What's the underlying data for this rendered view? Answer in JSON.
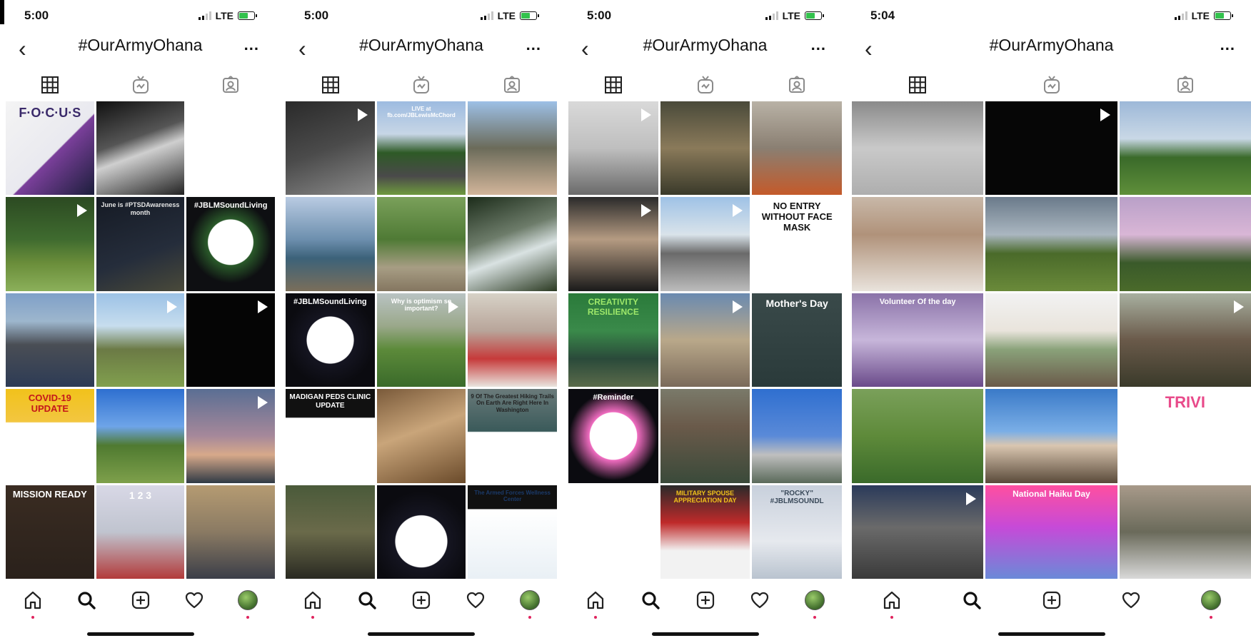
{
  "screens": [
    {
      "time": "5:00",
      "network": "LTE",
      "hashtag": "#OurArmyOhana",
      "more": "...",
      "tiles": [
        {
          "bg": "linear-gradient(135deg,#f4f4f4 0%,#e9e9ef 55%,#7a3f9a 56%,#1b1e3b 100%)",
          "text": "F·O·C·U·S",
          "fg": "#3a2a6a",
          "size": 18,
          "play": false
        },
        {
          "bg": "linear-gradient(160deg,#111 0%,#555 40%,#cfcfcf 55%,#222 100%)",
          "text": "",
          "play": false
        },
        {
          "bg": "#ffffff",
          "text": "",
          "play": false
        },
        {
          "bg": "linear-gradient(180deg,#2c4a22 0%,#3f6b2f 45%,#6a8d3a 70%,#8bb05a 100%)",
          "text": "",
          "play": true
        },
        {
          "bg": "linear-gradient(160deg,#151a24 0%,#252d3b 60%,#4a4a3a 100%)",
          "text": "June is #PTSDAwareness month",
          "fg": "#e6e6e6",
          "size": 9,
          "play": false
        },
        {
          "bg": "radial-gradient(circle at 50% 48%,#ffffff 0%,#ffffff 34%,#2a5a2a 35%,#0e0f12 62%)",
          "text": "#JBLMSoundLiving",
          "fg": "#ffffff",
          "size": 11,
          "play": false
        },
        {
          "bg": "linear-gradient(180deg,#7fa0c8 0%,#9db6cd 30%,#4a4e55 55%,#2d3b55 100%)",
          "text": "",
          "play": false
        },
        {
          "bg": "linear-gradient(180deg,#9cc2e6 0%,#c7ddee 35%,#6b7a45 60%,#81a04e 100%)",
          "text": "",
          "play": true
        },
        {
          "bg": "#050505",
          "text": "",
          "play": true
        },
        {
          "bg": "linear-gradient(180deg,#f1c21b 0%,#f3c640 35%,#ffffff 36%,#ffffff 100%)",
          "text": "COVID-19 UPDATE",
          "fg": "#c4171a",
          "size": 13,
          "play": false
        },
        {
          "bg": "linear-gradient(180deg,#2e6fd0 0%,#6ea4e8 40%,#4f7a30 60%,#7ea04b 100%)",
          "text": "",
          "play": false
        },
        {
          "bg": "linear-gradient(180deg,#5a6e93 0%,#a6889a 50%,#d7a98a 70%,#303a45 100%)",
          "text": "",
          "play": true
        },
        {
          "bg": "linear-gradient(180deg,#3a2c22 0%,#2a211b 100%)",
          "text": "MISSION READY",
          "fg": "#ffffff",
          "size": 13,
          "play": false
        },
        {
          "bg": "linear-gradient(180deg,#d8d8e6 0%,#c0c4cf 50%,#b23a3a 100%)",
          "text": "1  2  3",
          "fg": "#ffffff",
          "size": 14,
          "play": false
        },
        {
          "bg": "linear-gradient(180deg,#b59b72 0%,#8a7a63 50%,#3b3e48 100%)",
          "text": "",
          "play": false
        }
      ]
    },
    {
      "time": "5:00",
      "network": "LTE",
      "hashtag": "#OurArmyOhana",
      "more": "...",
      "tiles": [
        {
          "bg": "linear-gradient(160deg,#2a2a2a 0%,#4b4b4b 50%,#8a8a8a 100%)",
          "text": "",
          "play": true
        },
        {
          "bg": "linear-gradient(180deg,#9dbbe0 0%,#c7d6e6 35%,#2e5a26 55%,#4a4a4a 80%,#6e9a3e 100%)",
          "text": "LIVE at fb.com/JBLewisMcChord",
          "fg": "#ffffff",
          "size": 8,
          "play": false
        },
        {
          "bg": "linear-gradient(180deg,#9dc0e6 0%,#6b6b5a 50%,#d2b59a 100%)",
          "text": "",
          "play": false
        },
        {
          "bg": "linear-gradient(180deg,#b9cbe2 0%,#6d8fae 45%,#3c6279 65%,#7a6e5a 100%)",
          "text": "",
          "play": false
        },
        {
          "bg": "linear-gradient(180deg,#7aa05a 0%,#4f7a35 45%,#a79d84 75%,#847660 100%)",
          "text": "",
          "play": false
        },
        {
          "bg": "linear-gradient(160deg,#1c2c1a 0%,#6d7c6a 40%,#d9e2e2 60%,#2b3a22 100%)",
          "text": "",
          "play": false
        },
        {
          "bg": "radial-gradient(circle at 50% 50%,#ffffff 0%,#ffffff 36%,#151521 37%,#0b0b10 70%)",
          "text": "#JBLMSoundLiving",
          "fg": "#ffffff",
          "size": 11,
          "play": false
        },
        {
          "bg": "linear-gradient(180deg,#b9c3c3 0%,#9aa88a 35%,#5c8a3a 60%,#3a6a2a 100%)",
          "text": "Why is optimism so important?",
          "fg": "#ffffff",
          "size": 9,
          "play": true
        },
        {
          "bg": "linear-gradient(180deg,#d7d2c7 0%,#b8a59a 40%,#c63a3a 70%,#e9e4de 100%)",
          "text": "",
          "play": false
        },
        {
          "bg": "linear-gradient(180deg,#111 0%,#111 30%,#ffffff 31%,#ffffff 100%)",
          "text": "MADIGAN PEDS CLINIC UPDATE",
          "fg": "#ffffff",
          "size": 10,
          "play": false
        },
        {
          "bg": "linear-gradient(160deg,#7a5a3a 0%,#c9a57a 45%,#6a4a2a 100%)",
          "text": "",
          "play": false
        },
        {
          "bg": "linear-gradient(180deg,#6a7a7a 0%,#3a5a5a 45%,#ffffff 46%,#ffffff 100%)",
          "text": "9 Of The Greatest Hiking Trails On Earth Are Right Here In Washington",
          "fg": "#222222",
          "size": 8,
          "play": false
        },
        {
          "bg": "linear-gradient(180deg,#4a5a3a 0%,#6a6a4a 50%,#2a2a22 100%)",
          "text": "",
          "play": false
        },
        {
          "bg": "radial-gradient(circle at 50% 60%,#ffffff 0%,#ffffff 36%,#151521 37%,#0b0b10 70%)",
          "text": "",
          "play": false
        },
        {
          "bg": "linear-gradient(180deg,#111 0%,#111 25%,#ffffff 26%,#e9f0f5 100%)",
          "text": "The Armed Forces Wellness Center",
          "fg": "#1b3a6a",
          "size": 8,
          "play": false
        }
      ]
    },
    {
      "time": "5:00",
      "network": "LTE",
      "hashtag": "#OurArmyOhana",
      "more": "...",
      "tiles": [
        {
          "bg": "linear-gradient(180deg,#d9d9d9 0%,#bfbfbf 50%,#6a6a6a 100%)",
          "text": "",
          "play": true
        },
        {
          "bg": "linear-gradient(180deg,#4a4a3a 0%,#8a7a5a 50%,#3a3a2a 100%)",
          "text": "",
          "play": false
        },
        {
          "bg": "linear-gradient(180deg,#b9b2a6 0%,#8a7f72 50%,#c45a2a 100%)",
          "text": "",
          "play": false
        },
        {
          "bg": "linear-gradient(180deg,#2a2a2a 0%,#b59b82 45%,#1a1a1a 100%)",
          "text": "",
          "play": true
        },
        {
          "bg": "linear-gradient(180deg,#9fc2e6 0%,#d9e3ea 40%,#6a6a6a 60%,#bcbcbc 100%)",
          "text": "",
          "play": true
        },
        {
          "bg": "#ffffff",
          "text": "NO ENTRY WITHOUT FACE MASK",
          "fg": "#111111",
          "size": 13,
          "play": false
        },
        {
          "bg": "linear-gradient(180deg,#2a7a3a 0%,#3a8a4a 40%,#2a4a3a 70%,#5a6a4a 100%)",
          "text": "CREATIVITY RESILIENCE",
          "fg": "#9ee86a",
          "size": 12,
          "play": false
        },
        {
          "bg": "linear-gradient(180deg,#6a8ab0 0%,#b9a88a 50%,#7a6a5a 100%)",
          "text": "",
          "play": true
        },
        {
          "bg": "linear-gradient(180deg,#3a4a4a 0%,#2a3a3a 100%)",
          "text": "Mother's Day",
          "fg": "#ffffff",
          "size": 14,
          "play": false
        },
        {
          "bg": "radial-gradient(circle at 50% 50%,#ffffff 0%,#ffffff 36%,#f06cc0 37%,#0b0b10 68%)",
          "text": "#Reminder",
          "fg": "#ffffff",
          "size": 11,
          "play": false
        },
        {
          "bg": "linear-gradient(180deg,#7a7a6a 0%,#6a5a4a 40%,#3a4a3a 100%)",
          "text": "",
          "play": false
        },
        {
          "bg": "linear-gradient(180deg,#2f6fd0 0%,#5a8ad8 50%,#bfbfbf 70%,#5a6a5a 100%)",
          "text": "",
          "play": false
        },
        {
          "bg": "#ffffff",
          "text": "",
          "play": false
        },
        {
          "bg": "linear-gradient(180deg,#2a2a2a 0%,#bf2a2a 40%,#f2f2f2 70%,#f2f2f2 100%)",
          "text": "MILITARY SPOUSE APPRECIATION DAY",
          "fg": "#f1c21b",
          "size": 9,
          "play": false
        },
        {
          "bg": "linear-gradient(180deg,#c8d0dc 0%,#e6e9ee 60%,#b9c3cf 100%)",
          "text": "\"ROCKY\" #JBLMSOUNDL",
          "fg": "#3a4a5a",
          "size": 10,
          "play": false
        }
      ]
    },
    {
      "time": "5:04",
      "network": "LTE",
      "hashtag": "#OurArmyOhana",
      "more": "...",
      "tiles": [
        {
          "bg": "linear-gradient(180deg,#8a8a8a 0%,#c9c9c9 50%,#aeaeae 100%)",
          "text": "",
          "play": false
        },
        {
          "bg": "#060606",
          "text": "",
          "play": true
        },
        {
          "bg": "linear-gradient(180deg,#9db8d8 0%,#c9d8e6 40%,#3a6a2a 60%,#5f8f3a 100%)",
          "text": "",
          "play": false
        },
        {
          "bg": "linear-gradient(180deg,#c8b8a8 0%,#b0927a 40%,#e9e3dc 100%)",
          "text": "",
          "play": false
        },
        {
          "bg": "linear-gradient(180deg,#6a7a8a 0%,#aab6c0 40%,#4a6a2a 60%,#6a8a3a 100%)",
          "text": "",
          "play": false
        },
        {
          "bg": "linear-gradient(180deg,#b9a0c8 0%,#d9b6d6 40%,#3a5a2a 70%,#4a6a2a 100%)",
          "text": "",
          "play": false
        },
        {
          "bg": "linear-gradient(180deg,#8a72a8 0%,#c7b6da 50%,#6a4a8a 100%)",
          "text": "Volunteer Of the day",
          "fg": "#ffffff",
          "size": 11,
          "play": false
        },
        {
          "bg": "linear-gradient(180deg,#f2f2f2 0%,#e9e4dc 40%,#8aa27a 60%,#6a5a4a 100%)",
          "text": "",
          "play": false
        },
        {
          "bg": "linear-gradient(180deg,#a8b0a0 0%,#6a5a4a 50%,#3a3a2a 100%)",
          "text": "",
          "play": true
        },
        {
          "bg": "linear-gradient(180deg,#7aa05a 0%,#5e8a3a 50%,#3a6a2a 100%)",
          "text": "",
          "play": false
        },
        {
          "bg": "linear-gradient(180deg,#3a7ac8 0%,#7aaee6 45%,#d9c6b0 60%,#5a4a3a 100%)",
          "text": "",
          "play": false
        },
        {
          "bg": "#ffffff",
          "text": "TRIVI",
          "fg": "#e84a8a",
          "size": 22,
          "play": false
        },
        {
          "bg": "linear-gradient(180deg,#2a3a5a 0%,#6a6a6a 45%,#3a3a3a 100%)",
          "text": "",
          "play": true
        },
        {
          "bg": "linear-gradient(180deg,#ff4fa0 0%,#c64ad8 45%,#6a8ad8 100%)",
          "text": "National Haiku Day",
          "fg": "#ffffff",
          "size": 12,
          "play": false
        },
        {
          "bg": "linear-gradient(180deg,#a89a8a 0%,#6a6a5a 50%,#d9d9d9 100%)",
          "text": "",
          "play": false
        }
      ]
    }
  ],
  "icons": {
    "back": "back-chevron",
    "tab_grid": "grid-icon",
    "tab_igtv": "igtv-icon",
    "tab_tagged": "tagged-icon",
    "home": "home-icon",
    "search": "search-icon",
    "add": "add-post-icon",
    "activity": "heart-icon",
    "profile": "profile-avatar"
  },
  "colors": {
    "notification_dot": "#e0245e",
    "battery_fill": "#33c24d"
  }
}
